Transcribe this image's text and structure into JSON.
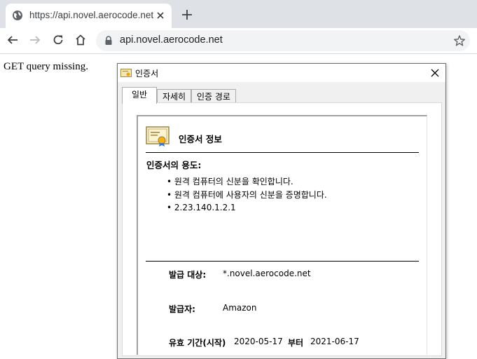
{
  "browser": {
    "tab_title": "https://api.novel.aerocode.net",
    "url": "api.novel.aerocode.net"
  },
  "page": {
    "body_text": "GET query missing."
  },
  "dialog": {
    "title": "인증서",
    "tabs": [
      "일반",
      "자세히",
      "인증 경로"
    ],
    "info_title": "인증서 정보",
    "purpose_heading": "인증서의 용도:",
    "purposes": [
      "• 원격 컴퓨터의 신분을 확인합니다.",
      "• 원격 컴퓨터에 사용자의 신분을 증명합니다.",
      "• 2.23.140.1.2.1"
    ],
    "issued_to_label": "발급 대상:",
    "issued_to": "*.novel.aerocode.net",
    "issued_by_label": "발급자:",
    "issued_by": "Amazon",
    "validity_label": "유효 기간(시작)",
    "valid_from": "2020-05-17",
    "validity_to_label": "부터",
    "valid_to": "2021-06-17"
  },
  "colors": {
    "tabstrip": "#dee1e6",
    "omnibox": "#f1f3f4",
    "dialog_bg": "#f0f0f0"
  }
}
